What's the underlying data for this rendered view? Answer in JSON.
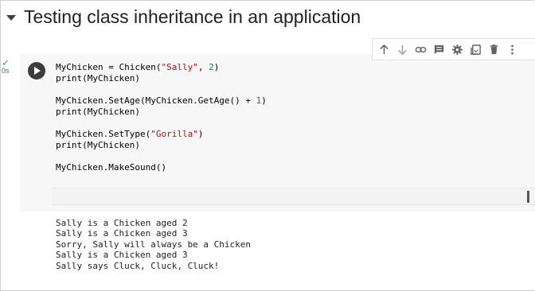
{
  "section": {
    "title": "Testing class inheritance in an application"
  },
  "toolbar": {
    "icons": [
      "arrow-up-icon",
      "arrow-down-icon",
      "link-icon",
      "comment-icon",
      "gear-icon",
      "mirror-cell-icon",
      "delete-icon",
      "more-options-icon"
    ]
  },
  "cell": {
    "status_check": "✓",
    "status_time": "0s",
    "code_lines": [
      "MyChicken = Chicken(\"Sally\", 2)",
      "print(MyChicken)",
      "",
      "MyChicken.SetAge(MyChicken.GetAge() + 1)",
      "print(MyChicken)",
      "",
      "MyChicken.SetType(\"Gorilla\")",
      "print(MyChicken)",
      "",
      "MyChicken.MakeSound()"
    ],
    "output_lines": [
      "Sally is a Chicken aged 2",
      "Sally is a Chicken aged 3",
      "Sorry, Sally will always be a Chicken",
      "Sally is a Chicken aged 3",
      "Sally says Cluck, Cluck, Cluck!"
    ]
  }
}
